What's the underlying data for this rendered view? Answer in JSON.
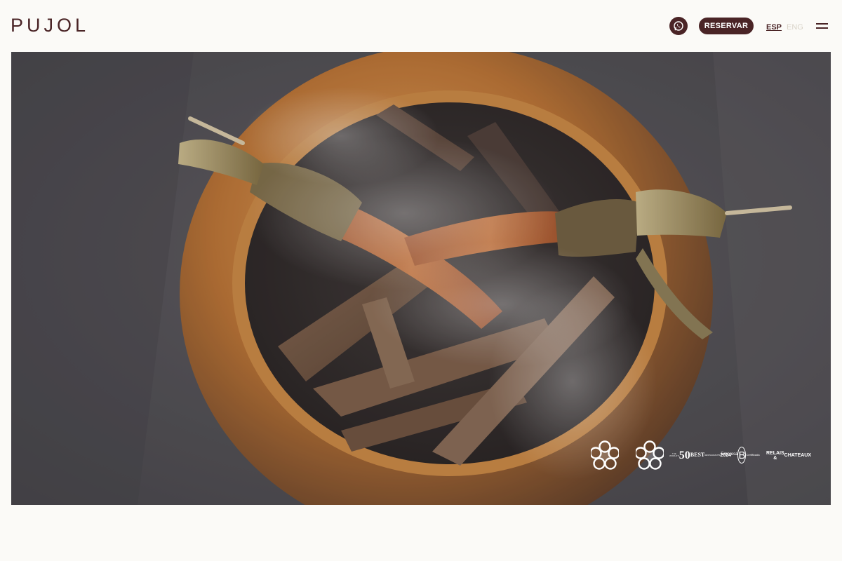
{
  "header": {
    "logo": "PUJOL",
    "whatsapp_icon": "whatsapp-icon",
    "reserve_label": "RESERVAR",
    "lang_esp": "ESP",
    "lang_eng": "ENG",
    "menu_icon": "hamburger-menu-icon"
  },
  "hero": {
    "image": "smoking-gourd-with-husk-wrapped-dish",
    "awards": {
      "michelin_star_1": "michelin-star-icon",
      "michelin_star_2": "michelin-star-icon",
      "best50": {
        "small": "THE WORLD'S",
        "number": "50",
        "word": "BEST",
        "sub": "RESTAURANTS",
        "year": "2024"
      },
      "bcorp": {
        "top": "Empresa",
        "letter": "B",
        "bottom": "Certificada"
      },
      "relais": {
        "line1": "RELAIS &",
        "line2": "CHATEAUX"
      }
    }
  },
  "colors": {
    "brand": "#4a2426",
    "background": "#fbfaf7",
    "lang_inactive": "#d9d3c8"
  }
}
